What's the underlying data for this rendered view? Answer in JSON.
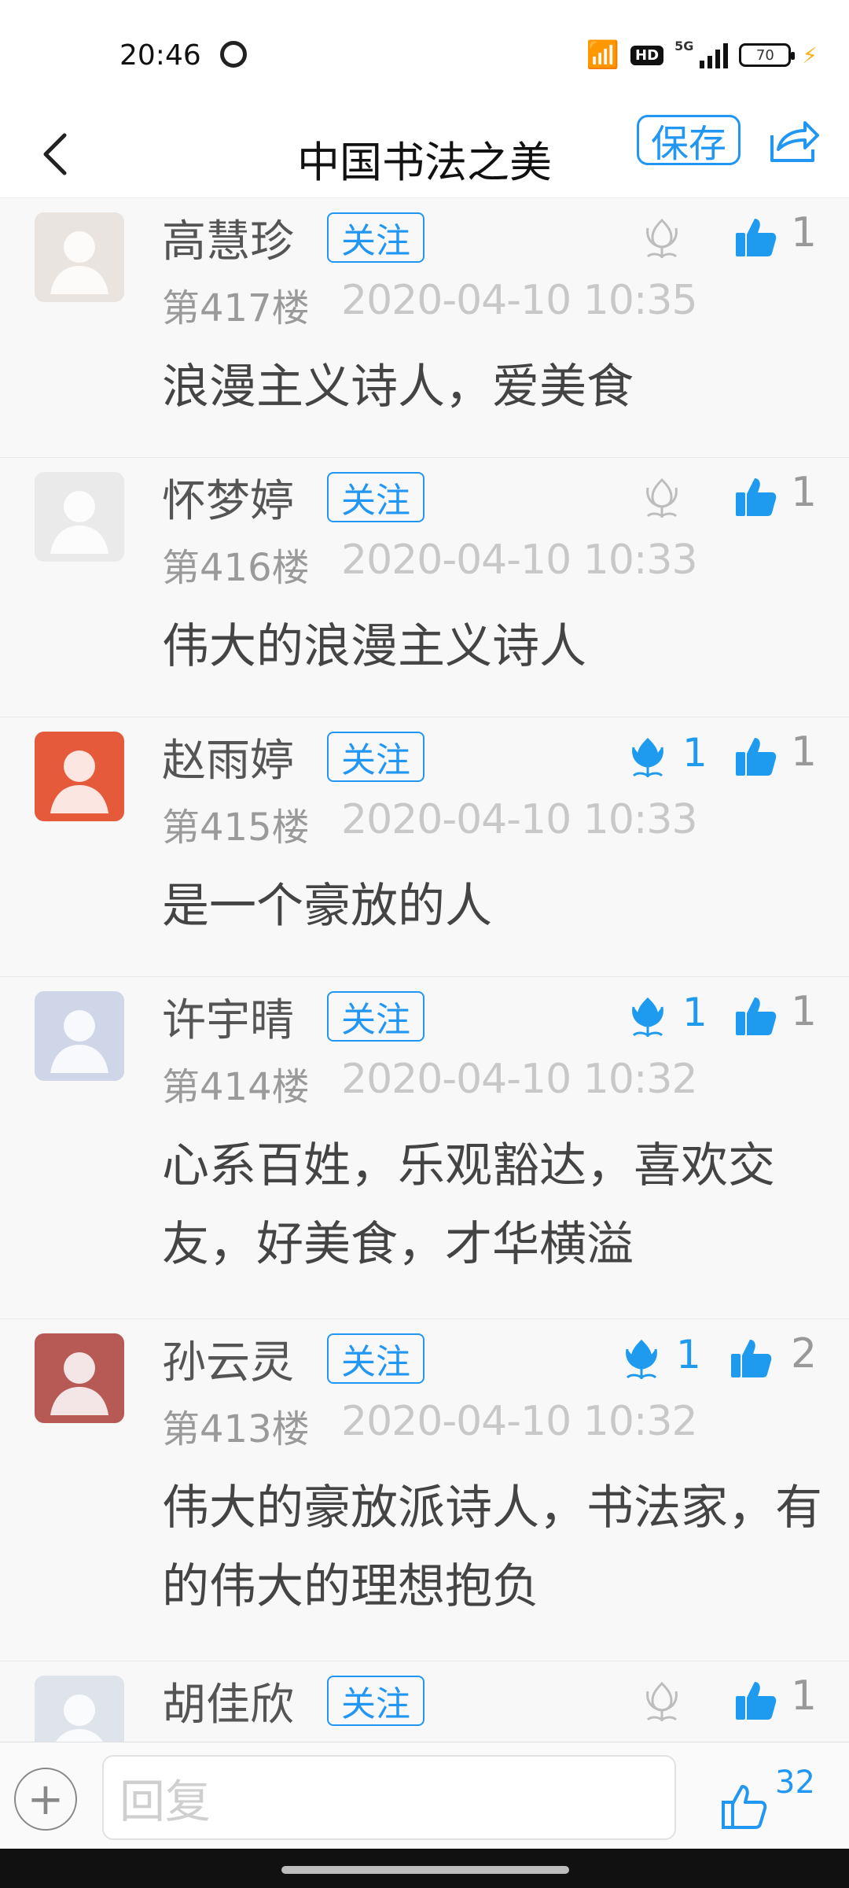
{
  "status_bar": {
    "time": "20:46",
    "network_icon": "ring-icon",
    "hd": "HD",
    "signal_5g": "5G",
    "battery": "70"
  },
  "nav": {
    "title": "中国书法之美",
    "save": "保存"
  },
  "comments": [
    {
      "name": "高慧珍",
      "follow": "关注",
      "floor": "第417楼",
      "date": "2020-04-10 10:35",
      "text": "浪漫主义诗人，爱美食",
      "flower_active": false,
      "flower_count": "",
      "likes": "1",
      "avatar_color": "#e9e4df"
    },
    {
      "name": "怀梦婷",
      "follow": "关注",
      "floor": "第416楼",
      "date": "2020-04-10 10:33",
      "text": "伟大的浪漫主义诗人",
      "flower_active": false,
      "flower_count": "",
      "likes": "1",
      "avatar_color": "#eaeaea"
    },
    {
      "name": "赵雨婷",
      "follow": "关注",
      "floor": "第415楼",
      "date": "2020-04-10 10:33",
      "text": "是一个豪放的人",
      "flower_active": true,
      "flower_count": "1",
      "likes": "1",
      "avatar_color": "#e45a3a"
    },
    {
      "name": "许宇晴",
      "follow": "关注",
      "floor": "第414楼",
      "date": "2020-04-10 10:32",
      "text": "心系百姓，乐观豁达，喜欢交友，好美食，才华横溢",
      "flower_active": true,
      "flower_count": "1",
      "likes": "1",
      "avatar_color": "#cfd6e8"
    },
    {
      "name": "孙云灵",
      "follow": "关注",
      "floor": "第413楼",
      "date": "2020-04-10 10:32",
      "text": "伟大的豪放派诗人，书法家，有的伟大的理想抱负",
      "flower_active": true,
      "flower_count": "1",
      "likes": "2",
      "avatar_color": "#b75a56"
    },
    {
      "name": "胡佳欣",
      "follow": "关注",
      "floor": "",
      "date": "",
      "text": "",
      "flower_active": false,
      "flower_count": "",
      "likes": "1",
      "avatar_color": "#dfe3ea"
    }
  ],
  "bottom": {
    "reply_placeholder": "回复",
    "like_count": "32"
  },
  "colors": {
    "accent": "#2196f3",
    "flower_active": "#1e9bef",
    "flower_inactive": "#bdbdbd"
  }
}
